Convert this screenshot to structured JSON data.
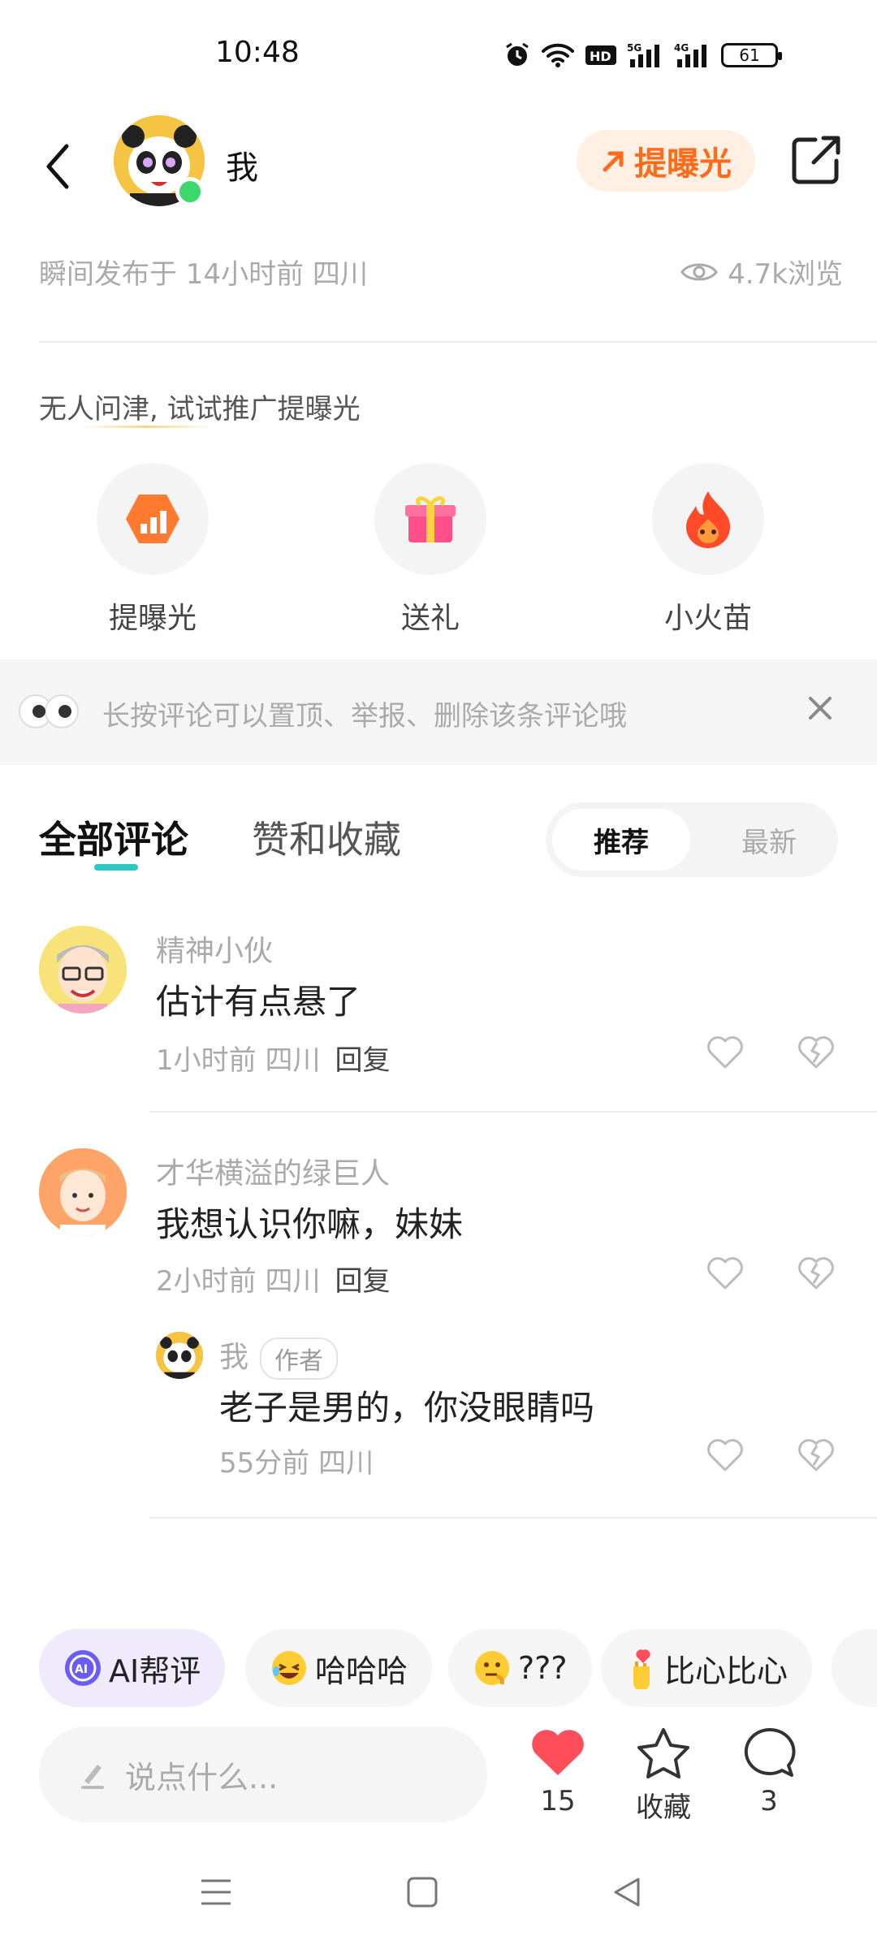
{
  "status_bar": {
    "time": "10:48",
    "battery": "61"
  },
  "header": {
    "username": "我",
    "boost_label": "提曝光"
  },
  "post_meta": {
    "posted": "瞬间发布于 14小时前 四川",
    "views": "4.7k浏览"
  },
  "promo": {
    "tip": "无人问津, 试试推广提曝光",
    "items": [
      {
        "label": "提曝光",
        "icon": "boost-icon"
      },
      {
        "label": "送礼",
        "icon": "gift-icon"
      },
      {
        "label": "小火苗",
        "icon": "flame-icon"
      }
    ]
  },
  "tip_banner": {
    "text": "长按评论可以置顶、举报、删除该条评论哦"
  },
  "tabs": {
    "all_comments": "全部评论",
    "likes_favs": "赞和收藏"
  },
  "sort": {
    "recommended": "推荐",
    "latest": "最新"
  },
  "comments": [
    {
      "name": "精神小伙",
      "text": "估计有点悬了",
      "time": "1小时前 四川",
      "reply": "回复"
    },
    {
      "name": "才华横溢的绿巨人",
      "text": "我想认识你嘛，妹妹",
      "time": "2小时前 四川",
      "reply": "回复",
      "sub_reply": {
        "name": "我",
        "badge": "作者",
        "text": "老子是男的，你没眼睛吗",
        "time": "55分前 四川"
      }
    }
  ],
  "quick_replies": [
    {
      "label": "AI帮评",
      "icon": "ai-icon"
    },
    {
      "label": "哈哈哈",
      "icon": "laughing-emoji"
    },
    {
      "label": "???",
      "icon": "thinking-emoji"
    },
    {
      "label": "比心比心",
      "icon": "finger-heart-emoji"
    }
  ],
  "bottom_bar": {
    "input_placeholder": "说点什么...",
    "likes": "15",
    "favorite_label": "收藏",
    "comments": "3"
  },
  "colors": {
    "accent_orange": "#ff6b1a",
    "tab_underline": "#2cc7c0",
    "like_red": "#ff4d5a",
    "online": "#3dd86b"
  }
}
